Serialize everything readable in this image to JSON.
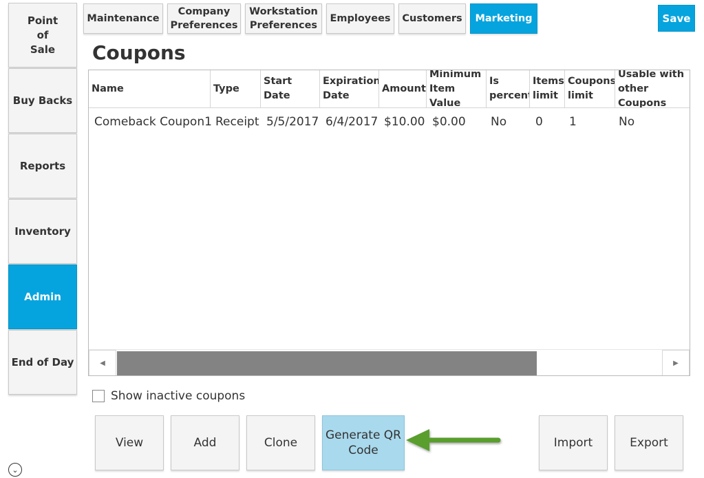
{
  "sidebar": {
    "items": [
      {
        "label": "Point\nof\nSale",
        "active": false
      },
      {
        "label": "Buy Backs",
        "active": false
      },
      {
        "label": "Reports",
        "active": false
      },
      {
        "label": "Inventory",
        "active": false
      },
      {
        "label": "Admin",
        "active": true
      },
      {
        "label": "End of Day",
        "active": false
      }
    ]
  },
  "tabs": [
    {
      "label": "Maintenance",
      "active": false
    },
    {
      "label": "Company\nPreferences",
      "active": false
    },
    {
      "label": "Workstation\nPreferences",
      "active": false
    },
    {
      "label": "Employees",
      "active": false
    },
    {
      "label": "Customers",
      "active": false
    },
    {
      "label": "Marketing",
      "active": true
    }
  ],
  "save_label": "Save",
  "page_title": "Coupons",
  "table": {
    "columns": [
      "Name",
      "Type",
      "Start\nDate",
      "Expiration\nDate",
      "Amount",
      "Minimum\nItem Value",
      "Is\npercent",
      "Items\nlimit",
      "Coupons\nlimit",
      "Usable with\nother Coupons"
    ],
    "rows": [
      [
        "Comeback Coupon1",
        "Receipt",
        "5/5/2017",
        "6/4/2017",
        "$10.00",
        "$0.00",
        "No",
        "0",
        "1",
        "No"
      ]
    ]
  },
  "show_inactive_label": "Show inactive coupons",
  "show_inactive_checked": false,
  "buttons": {
    "view": "View",
    "add": "Add",
    "clone": "Clone",
    "generate_qr": "Generate QR\nCode",
    "import": "Import",
    "export": "Export"
  },
  "icons": {
    "scroll_left": "◀",
    "scroll_right": "▶",
    "down_circle": "⌄"
  },
  "colors": {
    "accent": "#06a4de",
    "highlight": "#a9d9ec",
    "annotation_arrow": "#5a9e2f"
  }
}
